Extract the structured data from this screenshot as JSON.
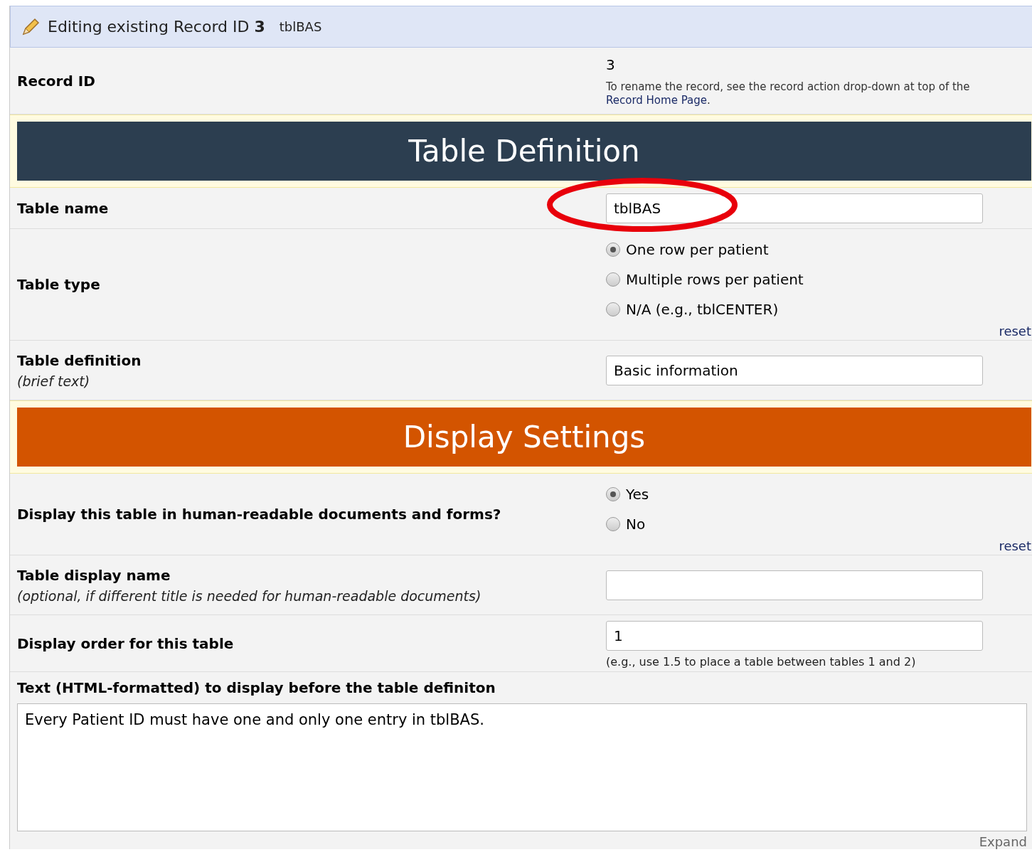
{
  "header": {
    "title": "Editing existing Record ID **3**",
    "table": "tblBAS"
  },
  "rows": [
    {
      "kind": "static",
      "label": "Record ID",
      "value": "3",
      "note": "To rename the record, see the record action drop-down at top of the",
      "link": "Record Home Page",
      "after_link": "."
    },
    {
      "kind": "section",
      "title": "Table Definition",
      "color": "#2c3e50"
    },
    {
      "kind": "input",
      "label": "Table name",
      "value": "tblBAS",
      "highlighted": true
    },
    {
      "kind": "radio",
      "label": "Table type",
      "options": [
        {
          "label": "One row per patient",
          "selected": true
        },
        {
          "label": "Multiple rows per patient",
          "selected": false
        },
        {
          "label": "N/A (e.g., tblCENTER)",
          "selected": false
        }
      ],
      "reset": "reset"
    },
    {
      "kind": "input",
      "label": "Table definition",
      "sublabel": "(brief text)",
      "value": "Basic information"
    },
    {
      "kind": "section",
      "title": "Display Settings",
      "color": "#d35400"
    },
    {
      "kind": "radio",
      "label": "Display this table in human-readable documents and forms?",
      "options": [
        {
          "label": "Yes",
          "selected": true
        },
        {
          "label": "No",
          "selected": false
        }
      ],
      "reset": "reset"
    },
    {
      "kind": "input",
      "label": "Table display name",
      "sublabel": "(optional, if different title is needed for human-readable documents)",
      "value": ""
    },
    {
      "kind": "input",
      "label": "Display order for this table",
      "value": "1",
      "hint": "(e.g., use 1.5 to place a table between tables 1 and 2)"
    },
    {
      "kind": "textarea",
      "label": "Text (HTML-formatted) to display before the table definiton",
      "value": "Every Patient ID must have one and only one entry in tblBAS.",
      "expand": "Expand"
    }
  ]
}
